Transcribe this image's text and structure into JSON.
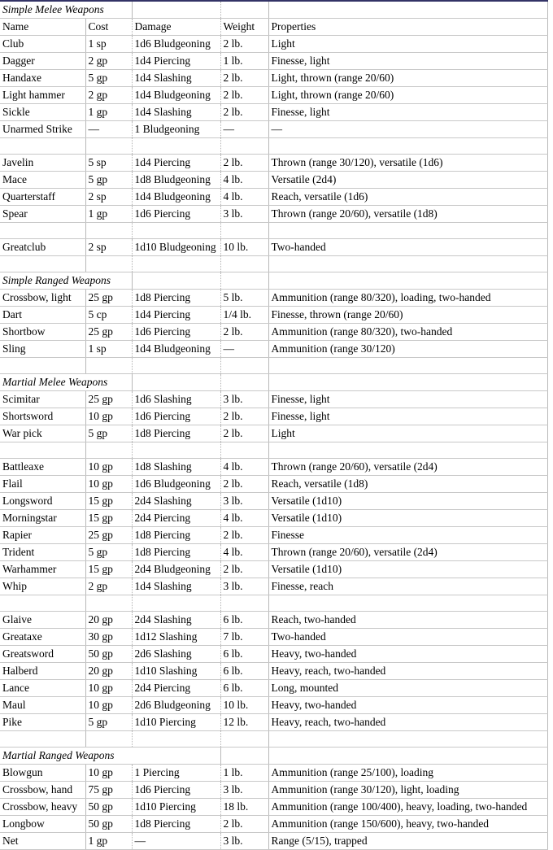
{
  "table": {
    "columns": [
      "Name",
      "Cost",
      "Damage",
      "Weight",
      "Properties"
    ],
    "header_row": {
      "name": "Name",
      "cost": "Cost",
      "damage": "Damage",
      "weight": "Weight",
      "properties": "Properties"
    },
    "sections": [
      {
        "title": "Simple Melee Weapons",
        "title_span": 2,
        "rows": [
          {
            "name": "Club",
            "cost": "1 sp",
            "damage": "1d6 Bludgeoning",
            "weight": "2 lb.",
            "properties": "Light"
          },
          {
            "name": "Dagger",
            "cost": "2 gp",
            "damage": "1d4 Piercing",
            "weight": "1 lb.",
            "properties": "Finesse, light"
          },
          {
            "name": "Handaxe",
            "cost": "5 gp",
            "damage": "1d4 Slashing",
            "weight": "2 lb.",
            "properties": "Light, thrown (range 20/60)"
          },
          {
            "name": "Light hammer",
            "cost": "2 gp",
            "damage": "1d4 Bludgeoning",
            "weight": "2 lb.",
            "properties": "Light, thrown (range 20/60)"
          },
          {
            "name": "Sickle",
            "cost": "1 gp",
            "damage": "1d4 Slashing",
            "weight": "2 lb.",
            "properties": "Finesse, light"
          },
          {
            "name": "Unarmed Strike",
            "cost": "—",
            "damage": "1 Bludgeoning",
            "weight": "—",
            "properties": "—"
          }
        ]
      },
      {
        "title": null,
        "rows": [
          {
            "name": "Javelin",
            "cost": "5 sp",
            "damage": "1d4 Piercing",
            "weight": "2 lb.",
            "properties": "Thrown (range 30/120), versatile (1d6)"
          },
          {
            "name": "Mace",
            "cost": "5 gp",
            "damage": "1d8 Bludgeoning",
            "weight": "4 lb.",
            "properties": "Versatile (2d4)"
          },
          {
            "name": "Quarterstaff",
            "cost": "2 sp",
            "damage": "1d4 Bludgeoning",
            "weight": "4 lb.",
            "properties": "Reach, versatile (1d6)"
          },
          {
            "name": "Spear",
            "cost": "1 gp",
            "damage": "1d6 Piercing",
            "weight": "3 lb.",
            "properties": "Thrown (range 20/60), versatile (1d8)"
          }
        ]
      },
      {
        "title": null,
        "rows": [
          {
            "name": "Greatclub",
            "cost": "2 sp",
            "damage": "1d10 Bludgeoning",
            "weight": "10 lb.",
            "properties": "Two-handed"
          }
        ]
      },
      {
        "title": "Simple Ranged Weapons",
        "title_span": 2,
        "rows": [
          {
            "name": "Crossbow, light",
            "cost": "25 gp",
            "damage": "1d8 Piercing",
            "weight": "5 lb.",
            "properties": "Ammunition (range 80/320), loading, two-handed"
          },
          {
            "name": "Dart",
            "cost": "5 cp",
            "damage": "1d4 Piercing",
            "weight": "1/4 lb.",
            "properties": "Finesse, thrown (range 20/60)"
          },
          {
            "name": "Shortbow",
            "cost": "25 gp",
            "damage": "1d6 Piercing",
            "weight": "2 lb.",
            "properties": "Ammunition (range 80/320), two-handed"
          },
          {
            "name": "Sling",
            "cost": "1 sp",
            "damage": "1d4 Bludgeoning",
            "weight": "—",
            "properties": "Ammunition (range 30/120)"
          }
        ]
      },
      {
        "title": "Martial Melee Weapons",
        "title_span": 2,
        "rows": [
          {
            "name": "Scimitar",
            "cost": "25 gp",
            "damage": "1d6 Slashing",
            "weight": "3 lb.",
            "properties": "Finesse, light"
          },
          {
            "name": "Shortsword",
            "cost": "10 gp",
            "damage": "1d6 Piercing",
            "weight": "2 lb.",
            "properties": "Finesse, light"
          },
          {
            "name": "War pick",
            "cost": "5 gp",
            "damage": "1d8 Piercing",
            "weight": "2 lb.",
            "properties": "Light"
          }
        ]
      },
      {
        "title": null,
        "rows": [
          {
            "name": "Battleaxe",
            "cost": "10 gp",
            "damage": "1d8 Slashing",
            "weight": "4 lb.",
            "properties": "Thrown (range 20/60), versatile (2d4)"
          },
          {
            "name": "Flail",
            "cost": "10 gp",
            "damage": "1d6 Bludgeoning",
            "weight": "2 lb.",
            "properties": "Reach, versatile (1d8)"
          },
          {
            "name": "Longsword",
            "cost": "15 gp",
            "damage": "2d4 Slashing",
            "weight": "3 lb.",
            "properties": "Versatile (1d10)"
          },
          {
            "name": "Morningstar",
            "cost": "15 gp",
            "damage": "2d4 Piercing",
            "weight": "4 lb.",
            "properties": "Versatile (1d10)"
          },
          {
            "name": "Rapier",
            "cost": "25 gp",
            "damage": "1d8 Piercing",
            "weight": "2 lb.",
            "properties": "Finesse"
          },
          {
            "name": "Trident",
            "cost": "5 gp",
            "damage": "1d8 Piercing",
            "weight": "4 lb.",
            "properties": "Thrown (range 20/60), versatile (2d4)"
          },
          {
            "name": "Warhammer",
            "cost": "15 gp",
            "damage": "2d4 Bludgeoning",
            "weight": "2 lb.",
            "properties": "Versatile (1d10)"
          },
          {
            "name": "Whip",
            "cost": "2 gp",
            "damage": "1d4 Slashing",
            "weight": "3 lb.",
            "properties": "Finesse, reach"
          }
        ]
      },
      {
        "title": null,
        "rows": [
          {
            "name": "Glaive",
            "cost": "20 gp",
            "damage": "2d4 Slashing",
            "weight": "6 lb.",
            "properties": "Reach, two-handed"
          },
          {
            "name": "Greataxe",
            "cost": "30 gp",
            "damage": "1d12 Slashing",
            "weight": "7 lb.",
            "properties": "Two-handed"
          },
          {
            "name": "Greatsword",
            "cost": "50 gp",
            "damage": "2d6 Slashing",
            "weight": "6 lb.",
            "properties": "Heavy, two-handed"
          },
          {
            "name": "Halberd",
            "cost": "20 gp",
            "damage": "1d10 Slashing",
            "weight": "6 lb.",
            "properties": "Heavy, reach, two-handed"
          },
          {
            "name": "Lance",
            "cost": "10 gp",
            "damage": "2d4 Piercing",
            "weight": "6 lb.",
            "properties": "Long, mounted"
          },
          {
            "name": "Maul",
            "cost": "10 gp",
            "damage": "2d6 Bludgeoning",
            "weight": "10 lb.",
            "properties": "Heavy, two-handed"
          },
          {
            "name": "Pike",
            "cost": "5 gp",
            "damage": "1d10 Piercing",
            "weight": "12 lb.",
            "properties": "Heavy, reach, two-handed"
          }
        ]
      },
      {
        "title": "Martial Ranged Weapons",
        "title_span": 3,
        "rows": [
          {
            "name": "Blowgun",
            "cost": "10 gp",
            "damage": "1 Piercing",
            "weight": "1 lb.",
            "properties": "Ammunition (range 25/100), loading"
          },
          {
            "name": "Crossbow, hand",
            "cost": "75 gp",
            "damage": "1d6 Piercing",
            "weight": "3 lb.",
            "properties": "Ammunition (range 30/120), light, loading"
          },
          {
            "name": "Crossbow, heavy",
            "cost": "50 gp",
            "damage": "1d10 Piercing",
            "weight": "18 lb.",
            "properties": "Ammunition (range 100/400), heavy, loading, two-handed"
          },
          {
            "name": "Longbow",
            "cost": "50 gp",
            "damage": "1d8 Piercing",
            "weight": "2 lb.",
            "properties": "Ammunition (range 150/600), heavy, two-handed"
          },
          {
            "name": "Net",
            "cost": "1 gp",
            "damage": "—",
            "weight": "3 lb.",
            "properties": "Range (5/15), trapped"
          }
        ]
      }
    ]
  },
  "style": {
    "grid_color": "#c8c8c8",
    "top_border_color": "#333366",
    "text_color": "#000000",
    "background": "#ffffff"
  }
}
